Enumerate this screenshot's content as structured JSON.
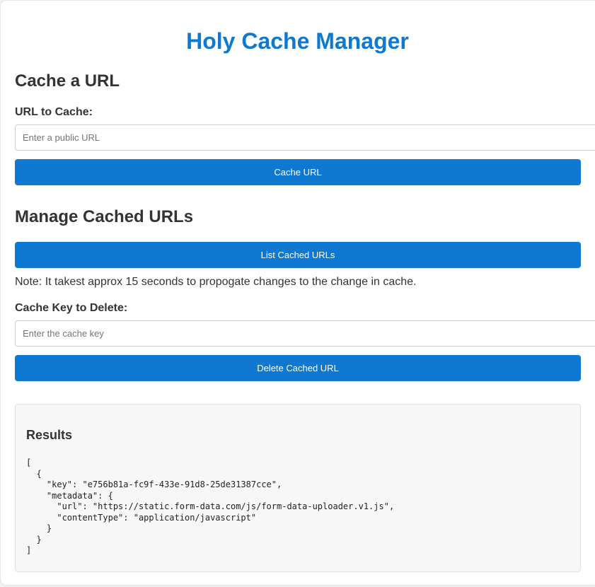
{
  "app": {
    "title": "Holy Cache Manager"
  },
  "cache_section": {
    "heading": "Cache a URL",
    "url_label": "URL to Cache:",
    "url_placeholder": "Enter a public URL",
    "url_value": "",
    "button_label": "Cache URL"
  },
  "manage_section": {
    "heading": "Manage Cached URLs",
    "list_button_label": "List Cached URLs",
    "note": "Note: It takest approx 15 seconds to propogate changes to the change in cache.",
    "key_label": "Cache Key to Delete:",
    "key_placeholder": "Enter the cache key",
    "key_value": "",
    "delete_button_label": "Delete Cached URL"
  },
  "results": {
    "title": "Results",
    "output": "[\n  {\n    \"key\": \"e756b81a-fc9f-433e-91d8-25de31387cce\",\n    \"metadata\": {\n      \"url\": \"https://static.form-data.com/js/form-data-uploader.v1.js\",\n      \"contentType\": \"application/javascript\"\n    }\n  }\n]"
  },
  "colors": {
    "accent": "#0f78d0",
    "text": "#333333",
    "results_background": "#f7f7f7"
  }
}
